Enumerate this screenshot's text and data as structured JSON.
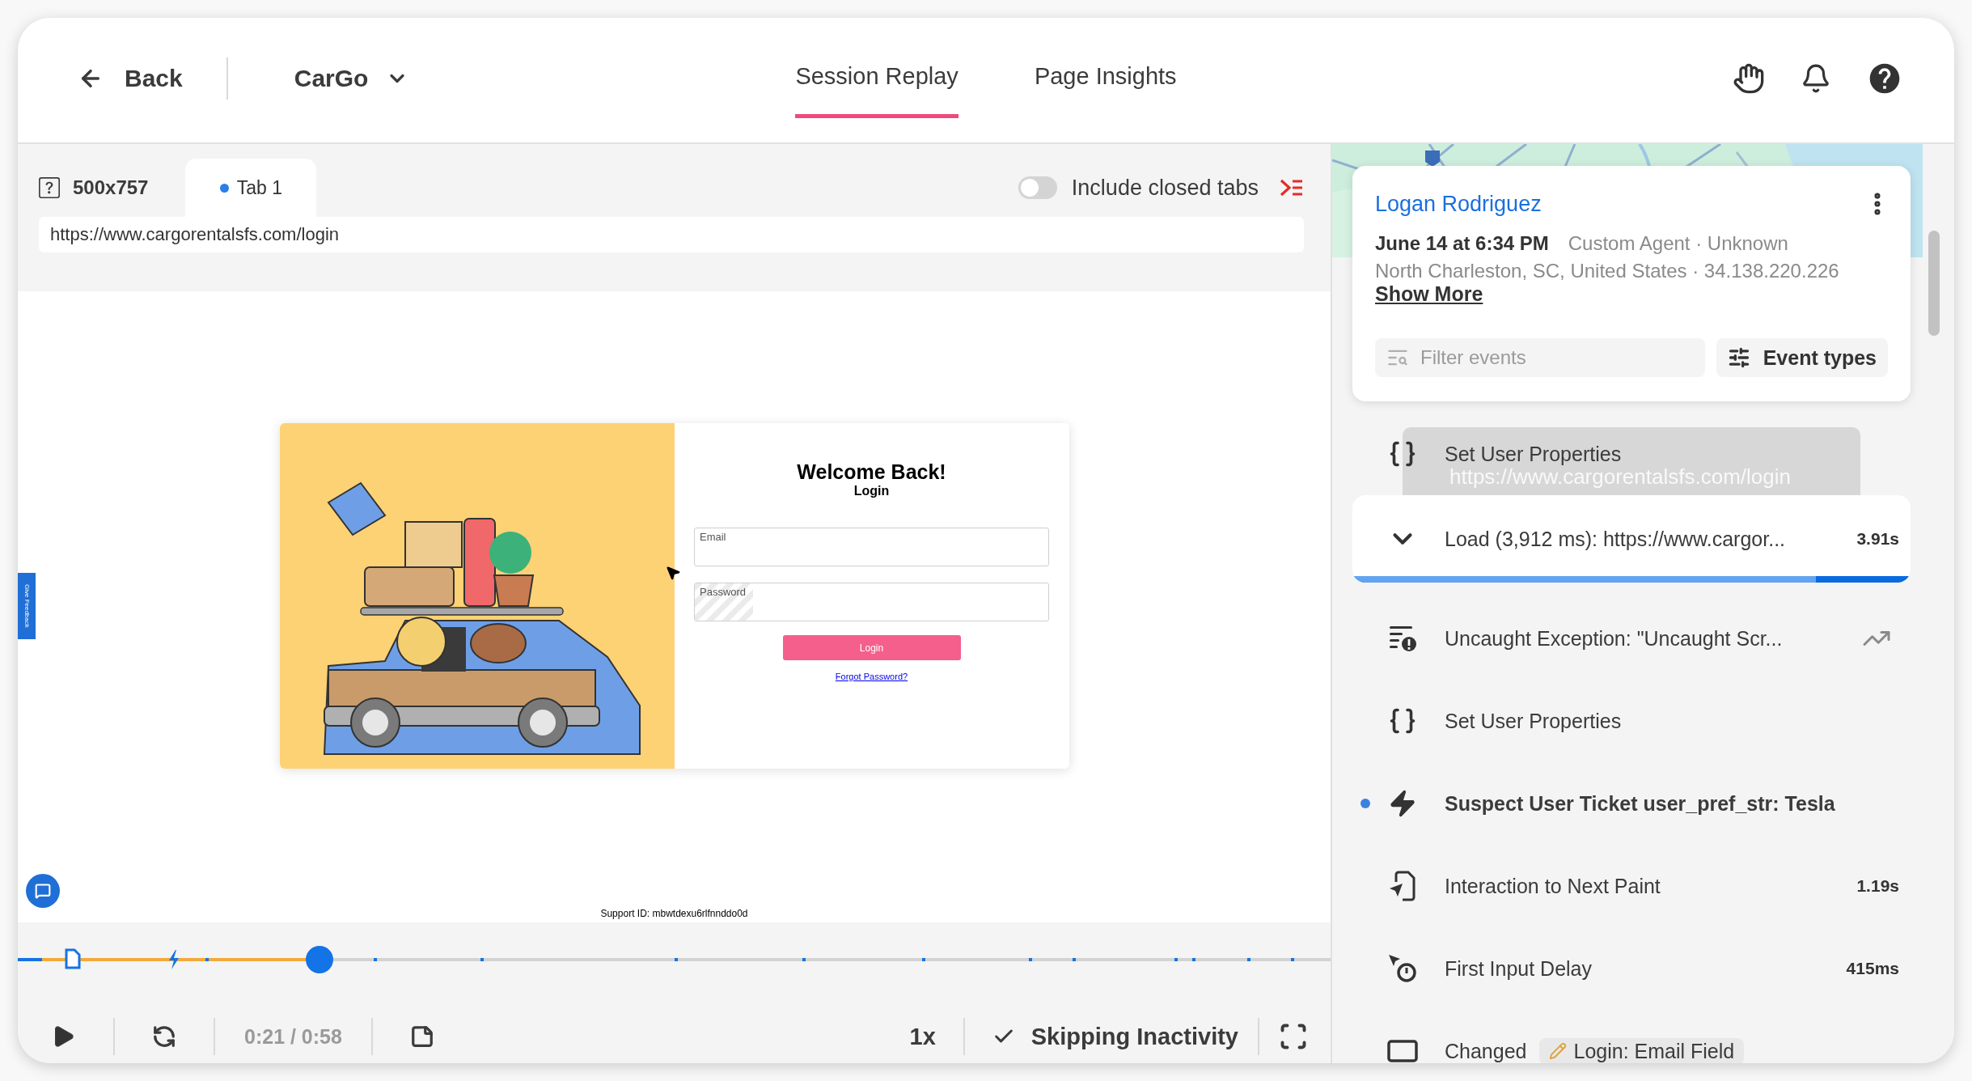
{
  "header": {
    "back_label": "Back",
    "project": "CarGo",
    "tabs": [
      {
        "label": "Session Replay",
        "selected": true
      },
      {
        "label": "Page Insights",
        "selected": false
      }
    ]
  },
  "replay": {
    "viewport": "500x757",
    "tabs": [
      {
        "label": "Tab 1",
        "selected": true
      }
    ],
    "include_closed_tabs": {
      "label": "Include closed tabs",
      "on": false
    },
    "url": "https://www.cargorentalsfs.com/login",
    "page": {
      "title": "Welcome Back!",
      "subtitle": "Login",
      "fields": [
        {
          "label": "Email"
        },
        {
          "label": "Password"
        }
      ],
      "button": "Login",
      "link": "Forgot Password?",
      "support_id": "Support ID: mbwtdexu6rlfnnddo0d",
      "feedback_tab": "Give Feedback"
    }
  },
  "player": {
    "level": 0.23,
    "time": "0:21 / 0:58",
    "speed": "1x",
    "skip_inactivity": {
      "label": "Skipping Inactivity",
      "on": true
    }
  },
  "session": {
    "user": "Logan Rodriguez",
    "date": "June 14 at 6:34 PM",
    "agent": "Custom Agent · Unknown",
    "location": "North Charleston, SC, United States · 34.138.220.226",
    "show_more": "Show More",
    "filter": {
      "placeholder": "Filter events"
    },
    "event_types": "Event types"
  },
  "tooltip": "https://www.cargorentalsfs.com/login",
  "events": [
    {
      "kind": "properties",
      "title": "Set User Properties",
      "selected": false,
      "current": false
    },
    {
      "kind": "load",
      "title": "Load (3,912 ms): https://www.cargor...",
      "value": "3.91s",
      "level": 0.83,
      "selected": true,
      "current": false
    },
    {
      "kind": "exception",
      "title": "Uncaught Exception: \"Uncaught Scr...",
      "selected": false,
      "current": false
    },
    {
      "kind": "properties",
      "title": "Set User Properties",
      "selected": false,
      "current": false
    },
    {
      "kind": "custom",
      "title": "Suspect User Ticket user_pref_str: Tesla",
      "selected": false,
      "current": true
    },
    {
      "kind": "inp",
      "title": "Interaction to Next Paint",
      "value": "1.19s",
      "selected": false,
      "current": false
    },
    {
      "kind": "fid",
      "title": "First Input Delay",
      "value": "415ms",
      "selected": false,
      "current": false
    },
    {
      "kind": "changed",
      "title": "Changed",
      "tag": "Login: Email Field",
      "selected": false,
      "current": false
    }
  ]
}
